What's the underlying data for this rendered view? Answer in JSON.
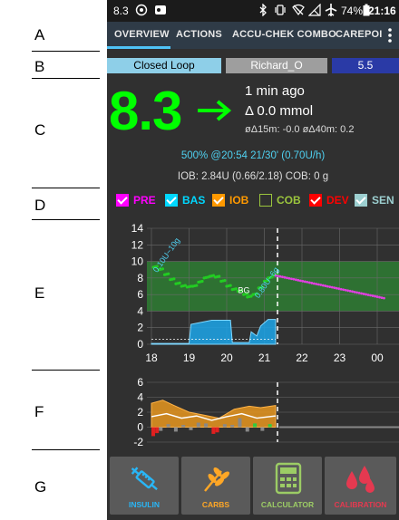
{
  "annotations": [
    "A",
    "B",
    "C",
    "D",
    "E",
    "F",
    "G"
  ],
  "statusbar": {
    "left_value": "8.3",
    "battery": "74%",
    "time": "21:16"
  },
  "tabs": [
    "OVERVIEW",
    "ACTIONS",
    "ACCU-CHEK COMBO",
    "CAREPOI"
  ],
  "active_tab": "OVERVIEW",
  "status_row": {
    "loop_mode": "Closed Loop",
    "profile": "Richard_O",
    "target": "5.5"
  },
  "bg": {
    "value": "8.3",
    "trend_icon": "arrow-right-icon",
    "time_ago": "1 min ago",
    "delta": "Δ 0.0 mmol",
    "avg_delta": "øΔ15m: -0.0  øΔ40m: 0.2"
  },
  "temp_basal": "500% @20:54 21/30' (0.70U/h)",
  "iob_cob": "IOB: 2.84U (0.66/2.18)   COB: 0 g",
  "legend": [
    {
      "label": "PRE",
      "color": "#ff00ff",
      "checked": true
    },
    {
      "label": "BAS",
      "color": "#00d8ff",
      "checked": true
    },
    {
      "label": "IOB",
      "color": "#ff9900",
      "checked": true
    },
    {
      "label": "COB",
      "color": "#9bc53d",
      "checked": false
    },
    {
      "label": "DEV",
      "color": "#ff0000",
      "checked": true
    },
    {
      "label": "SEN",
      "color": "#9ccfd0",
      "checked": true
    }
  ],
  "main_chart": {
    "y_ticks": [
      "14",
      "12",
      "10",
      "8",
      "6",
      "4",
      "2",
      "0"
    ],
    "x_ticks": [
      "18",
      "19",
      "20",
      "21",
      "22",
      "23",
      "00"
    ],
    "target_range": [
      4,
      10
    ],
    "annotations": [
      "0.10U~10g",
      "BG",
      "0.80U~6g"
    ],
    "colors": {
      "target": "#2e7d32",
      "bg": "#22cc22",
      "prediction": "#e040e0",
      "basal": "#1ea0e0"
    }
  },
  "dev_chart": {
    "y_ticks": [
      "6",
      "4",
      "2",
      "0",
      "-2"
    ]
  },
  "actions": [
    {
      "label": "INSULIN",
      "icon": "syringe-icon",
      "color": "#29b6f6"
    },
    {
      "label": "CARBS",
      "icon": "wheat-icon",
      "color": "#ffa726"
    },
    {
      "label": "CALCULATOR",
      "icon": "calculator-icon",
      "color": "#9ccc65"
    },
    {
      "label": "CALIBRATION",
      "icon": "blood-drop-icon",
      "color": "#e53950"
    }
  ]
}
